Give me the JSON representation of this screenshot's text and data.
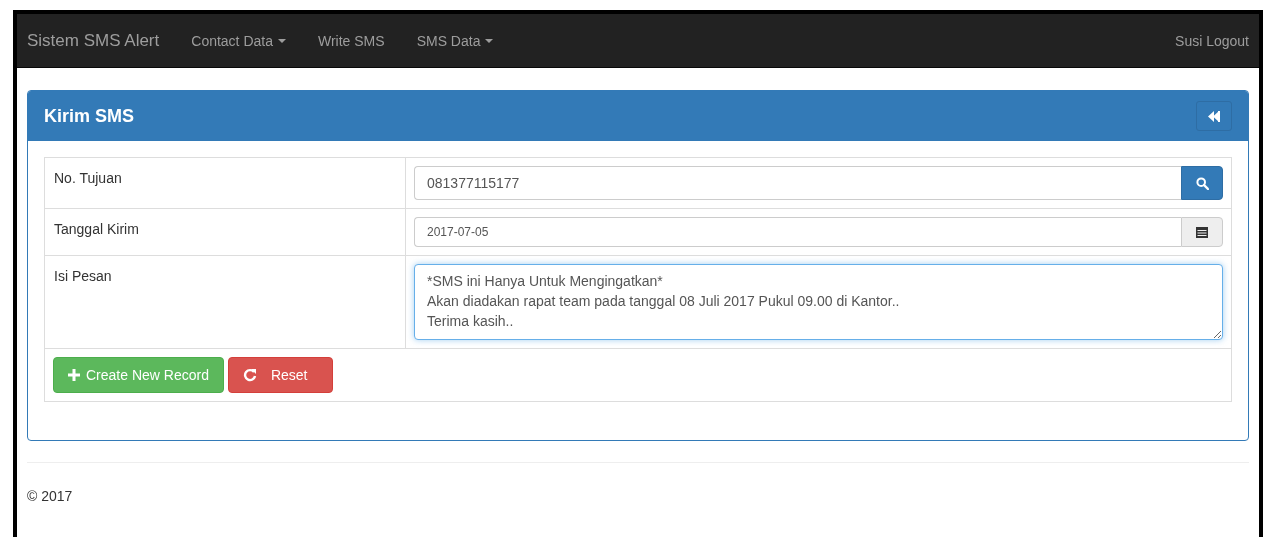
{
  "navbar": {
    "brand": "Sistem SMS Alert",
    "menu": [
      {
        "label": "Contact Data",
        "dropdown": true
      },
      {
        "label": "Write SMS",
        "dropdown": false
      },
      {
        "label": "SMS Data",
        "dropdown": true
      }
    ],
    "user_link": "Susi Logout"
  },
  "panel": {
    "title": "Kirim SMS",
    "fields": [
      {
        "kind": "search",
        "label": "No. Tujuan",
        "value": "081377115177"
      },
      {
        "kind": "date",
        "label": "Tanggal Kirim",
        "value": "2017-07-05"
      },
      {
        "kind": "textarea",
        "label": "Isi Pesan",
        "value": "*SMS ini Hanya Untuk Mengingatkan*\nAkan diadakan rapat team pada tanggal 08 Juli 2017 Pukul 09.00 di Kantor..\nTerima kasih..",
        "focused": true
      }
    ],
    "buttons": [
      {
        "kind": "success",
        "label": "Create New Record"
      },
      {
        "kind": "danger",
        "label": "Reset"
      }
    ]
  },
  "footer": {
    "text": "© 2017"
  }
}
